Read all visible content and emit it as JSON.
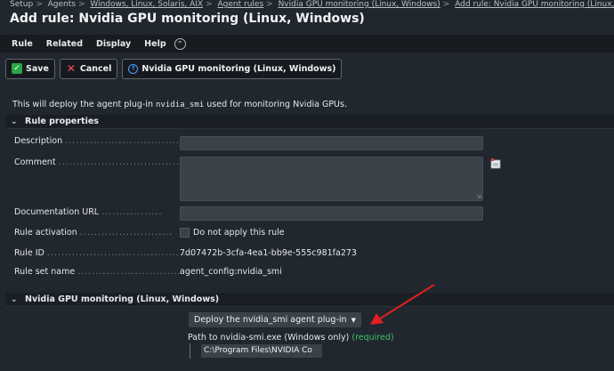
{
  "breadcrumb": {
    "items": [
      "Setup",
      "Agents",
      "Windows, Linux, Solaris, AIX",
      "Agent rules",
      "Nvidia GPU monitoring (Linux, Windows)",
      "Add rule: Nvidia GPU monitoring (Linux, Windo"
    ],
    "separator": ">"
  },
  "page": {
    "title": "Add rule: Nvidia GPU monitoring (Linux, Windows)"
  },
  "menu": {
    "items": [
      "Rule",
      "Related",
      "Display",
      "Help"
    ]
  },
  "toolbar": {
    "save_label": "Save",
    "cancel_label": "Cancel",
    "plugin_label": "Nvidia GPU monitoring (Linux, Windows)"
  },
  "intro": {
    "prefix": "This will deploy the agent plug-in ",
    "code": "nvidia_smi",
    "suffix": " used for monitoring Nvidia GPUs."
  },
  "rule_properties": {
    "header": "Rule properties",
    "description_label": "Description",
    "comment_label": "Comment",
    "doc_url_label": "Documentation URL",
    "activation_label": "Rule activation",
    "activation_checkbox_label": "Do not apply this rule",
    "rule_id_label": "Rule ID",
    "rule_id_value": "7d07472b-3cfa-4ea1-bb9e-555c981fa273",
    "ruleset_label": "Rule set name",
    "ruleset_value": "agent_config:nvidia_smi"
  },
  "nvidia_section": {
    "header": "Nvidia GPU monitoring (Linux, Windows)",
    "deploy_select": "Deploy the nvidia_smi agent plug-in",
    "path_label": "Path to nvidia-smi.exe (Windows only)",
    "required_label": "(required)",
    "path_value": "C:\\Program Files\\NVIDIA Co"
  },
  "colors": {
    "background": "#21272e",
    "accent_green": "#3bc26d",
    "cancel_red": "#ff4a4a",
    "annotation_arrow": "#e02020"
  },
  "icons": [
    "collapse-icon",
    "save-check-icon",
    "cancel-x-icon",
    "plugin-info-icon",
    "chevron-down-icon",
    "comment-insert-icon",
    "annotation-arrow-icon"
  ]
}
